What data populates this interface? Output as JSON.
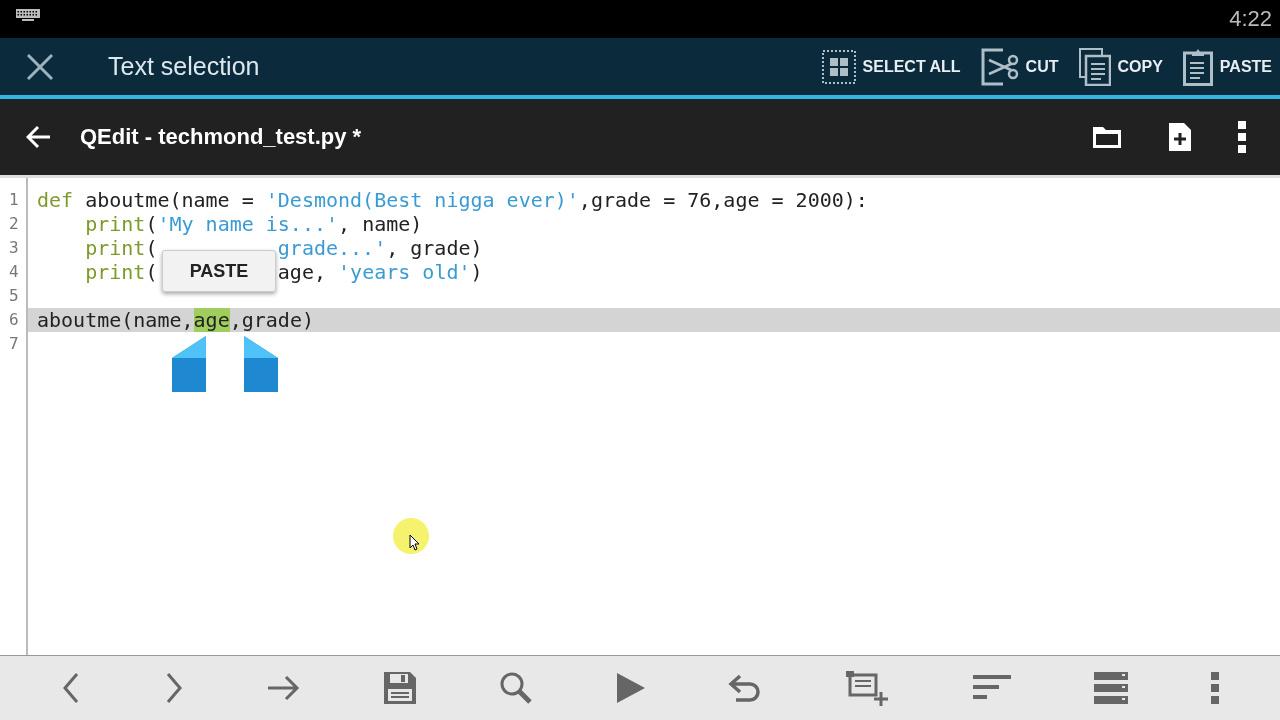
{
  "status_bar": {
    "time": "4:22"
  },
  "action_mode": {
    "title": "Text selection",
    "actions": [
      {
        "kind": "select_all",
        "label": "SELECT ALL"
      },
      {
        "kind": "cut",
        "label": "CUT"
      },
      {
        "kind": "copy",
        "label": "COPY"
      },
      {
        "kind": "paste",
        "label": "PASTE"
      }
    ]
  },
  "app_bar": {
    "title": "QEdit - techmond_test.py *"
  },
  "editor": {
    "lines": [
      {
        "number": "1",
        "current": false,
        "tokens": [
          {
            "kind": "keyword",
            "text": "def"
          },
          {
            "kind": "plain",
            "text": " aboutme(name = "
          },
          {
            "kind": "string",
            "text": "'Desmond(Best nigga ever)'"
          },
          {
            "kind": "plain",
            "text": ",grade = 76,age = 2000):"
          }
        ]
      },
      {
        "number": "2",
        "current": false,
        "indented": true,
        "tokens": [
          {
            "kind": "keyword",
            "text": "print"
          },
          {
            "kind": "plain",
            "text": "("
          },
          {
            "kind": "string",
            "text": "'My name is...'"
          },
          {
            "kind": "plain",
            "text": ", name)"
          }
        ]
      },
      {
        "number": "3",
        "current": false,
        "indented": true,
        "tokens": [
          {
            "kind": "keyword",
            "text": "print"
          },
          {
            "kind": "plain",
            "text": "("
          },
          {
            "kind": "string",
            "text": "grade...'",
            "after_gap": true
          },
          {
            "kind": "plain",
            "text": ", grade)"
          }
        ]
      },
      {
        "number": "4",
        "current": false,
        "indented": true,
        "tokens": [
          {
            "kind": "keyword",
            "text": "print"
          },
          {
            "kind": "plain",
            "text": "("
          },
          {
            "kind": "plain",
            "text": "age, ",
            "after_gap": true
          },
          {
            "kind": "string",
            "text": "'years old'"
          },
          {
            "kind": "plain",
            "text": ")"
          }
        ]
      },
      {
        "number": "5",
        "current": false
      },
      {
        "number": "6",
        "current": true,
        "tokens": [
          {
            "kind": "plain",
            "text": "aboutme(name,"
          },
          {
            "kind": "selected",
            "text": "age"
          },
          {
            "kind": "plain",
            "text": ",grade)"
          }
        ]
      },
      {
        "number": "7",
        "current": false
      }
    ],
    "popup": {
      "label": "PASTE"
    }
  }
}
